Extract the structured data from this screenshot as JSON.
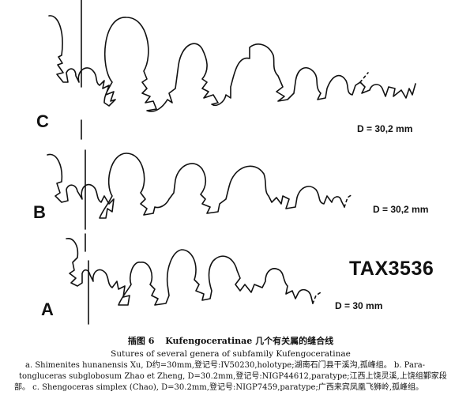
{
  "rows": [
    {
      "letter": "C",
      "diameter": "D = 30,2 mm"
    },
    {
      "letter": "B",
      "diameter": "D = 30,2 mm"
    },
    {
      "letter": "A",
      "diameter": "D = 30 mm"
    }
  ],
  "tax_label": "TAX3536",
  "caption": {
    "figure_number": "插图 6",
    "title": "Kufengoceratinae 几个有关属的缝合线",
    "subtitle_en": "Sutures of several genera of subfamily Kufengoceratinae",
    "lines": [
      "a. Shimenites hunanensis Xu, D约=30mm,登记号:IV50230,holotype;湖南石门县干溪沟,孤峰组。 b. Para-",
      "tongluceras subglobosum Zhao et Zheng, D=30.2mm,登记号:NIGP44612,paratype;江西上饶灵溪,上饶组鄞家段底",
      "部。 c. Shengoceras simplex (Chao), D=30.2mm,登记号:NIGP7459,paratype;广西来宾凤凰飞狮岭,孤峰组。"
    ]
  }
}
